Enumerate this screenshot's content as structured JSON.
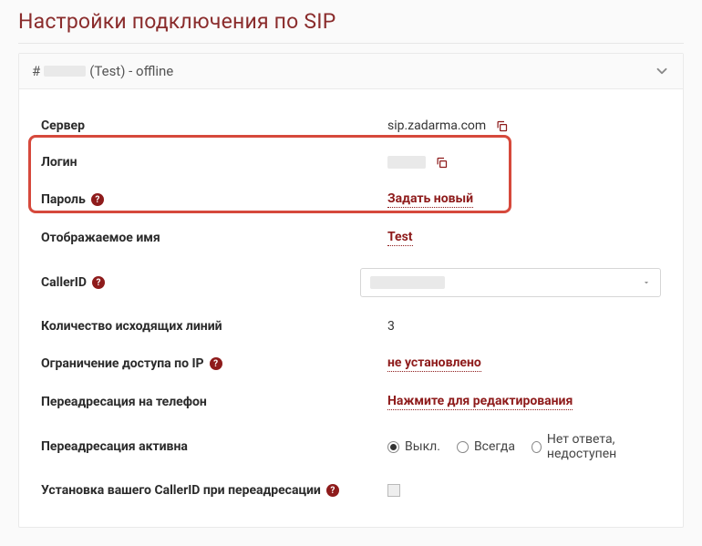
{
  "page": {
    "title": "Настройки подключения по SIP"
  },
  "accordion": {
    "header_suffix": "(Test) - offline",
    "hash": "#"
  },
  "rows": {
    "server": {
      "label": "Сервер",
      "value": "sip.zadarma.com"
    },
    "login": {
      "label": "Логин"
    },
    "password": {
      "label": "Пароль",
      "action": "Задать новый"
    },
    "display_name": {
      "label": "Отображаемое имя",
      "value": "Test"
    },
    "caller_id": {
      "label": "CallerID"
    },
    "out_lines": {
      "label": "Количество исходящих линий",
      "value": "3"
    },
    "ip_restrict": {
      "label": "Ограничение доступа по IP",
      "value": "не установлено"
    },
    "fwd_phone": {
      "label": "Переадресация на телефон",
      "value": "Нажмите для редактирования"
    },
    "fwd_active": {
      "label": "Переадресация активна"
    },
    "own_callerid": {
      "label": "Установка вашего CallerID при переадресации"
    }
  },
  "radios": {
    "off": "Выкл.",
    "always": "Всегда",
    "noanswer": "Нет ответа, недоступен"
  }
}
